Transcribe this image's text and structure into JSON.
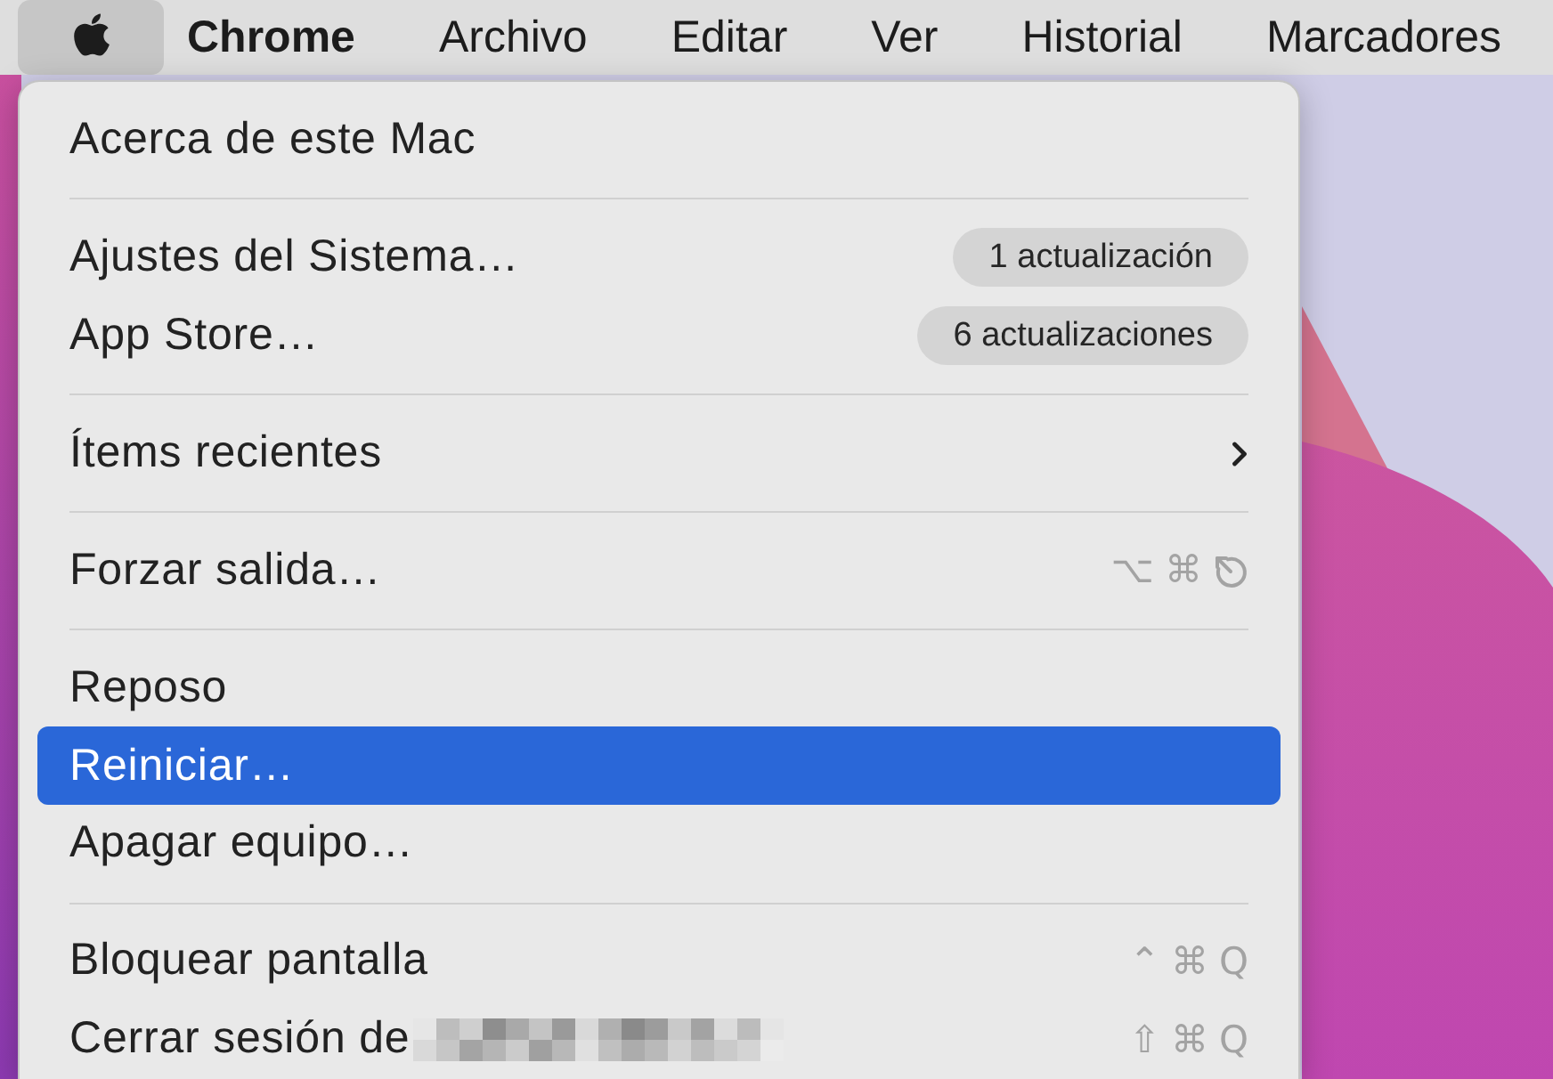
{
  "menu_bar": {
    "items": [
      {
        "kind": "apple",
        "selected": true
      },
      {
        "kind": "app",
        "label": "Chrome",
        "selected": false
      },
      {
        "kind": "menu",
        "label": "Archivo",
        "selected": false
      },
      {
        "kind": "menu",
        "label": "Editar",
        "selected": false
      },
      {
        "kind": "menu",
        "label": "Ver",
        "selected": false
      },
      {
        "kind": "menu",
        "label": "Historial",
        "selected": false
      },
      {
        "kind": "menu",
        "label": "Marcadores",
        "selected": false
      }
    ]
  },
  "menu": {
    "sections": [
      [
        {
          "label": "Acerca de este Mac",
          "selected": false,
          "submenu": false,
          "redacted": false
        }
      ],
      [
        {
          "label": "Ajustes del Sistema…",
          "selected": false,
          "submenu": false,
          "redacted": false,
          "badge": "1 actualización"
        },
        {
          "label": "App Store…",
          "selected": false,
          "submenu": false,
          "redacted": false,
          "badge": "6 actualizaciones"
        }
      ],
      [
        {
          "label": "Ítems recientes",
          "selected": false,
          "submenu": true,
          "redacted": false
        }
      ],
      [
        {
          "label": "Forzar salida…",
          "selected": false,
          "submenu": false,
          "redacted": false,
          "shortcut": [
            {
              "kind": "key",
              "label": "⌥"
            },
            {
              "kind": "key",
              "label": "⌘"
            },
            {
              "kind": "escape"
            }
          ]
        }
      ],
      [
        {
          "label": "Reposo",
          "selected": false,
          "submenu": false,
          "redacted": false
        },
        {
          "label": "Reiniciar…",
          "selected": true,
          "submenu": false,
          "redacted": false
        },
        {
          "label": "Apagar equipo…",
          "selected": false,
          "submenu": false,
          "redacted": false
        }
      ],
      [
        {
          "label": "Bloquear pantalla",
          "selected": false,
          "submenu": false,
          "redacted": false,
          "shortcut": [
            {
              "kind": "key",
              "label": "⌃"
            },
            {
              "kind": "key",
              "label": "⌘"
            },
            {
              "kind": "key",
              "label": "Q"
            }
          ]
        },
        {
          "label": "Cerrar sesión de",
          "selected": false,
          "submenu": false,
          "redacted": true,
          "shortcut": [
            {
              "kind": "key",
              "label": "⇧"
            },
            {
              "kind": "key",
              "label": "⌘"
            },
            {
              "kind": "key",
              "label": "Q"
            }
          ]
        }
      ]
    ]
  }
}
